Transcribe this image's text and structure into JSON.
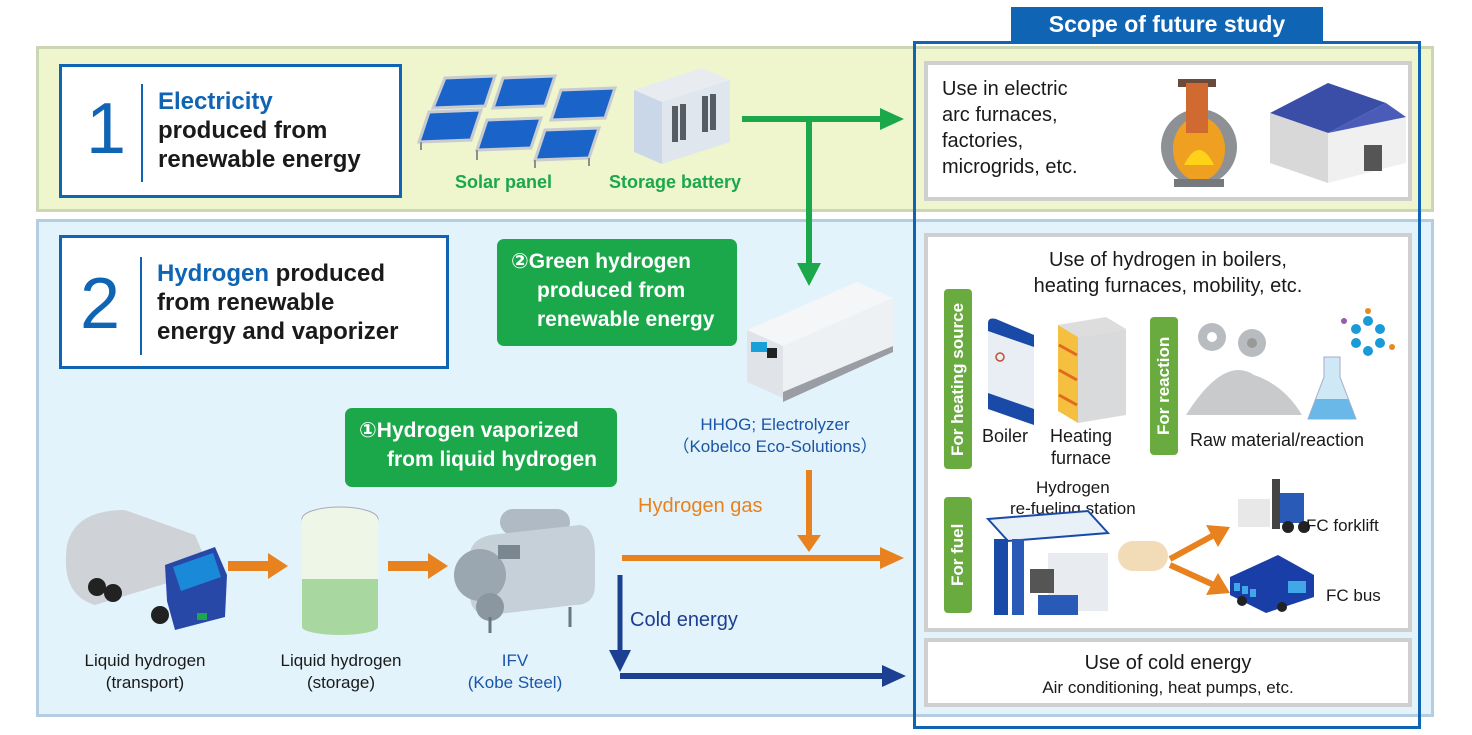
{
  "scope": {
    "title": "Scope of future study"
  },
  "section1": {
    "number": "1",
    "title_highlight": "Electricity",
    "title_line2": "produced from",
    "title_line3": "renewable energy",
    "solar_label": "Solar panel",
    "battery_label": "Storage battery"
  },
  "section2": {
    "number": "2",
    "title_highlight": "Hydrogen",
    "title_line1_rest": " produced",
    "title_line2": "from renewable",
    "title_line3": "energy and vaporizer",
    "green_box_2": {
      "line1": "②Green hydrogen",
      "line2": "produced from",
      "line3": "renewable energy"
    },
    "green_box_1": {
      "line1": "①Hydrogen vaporized",
      "line2": "from liquid hydrogen"
    },
    "electrolyzer_label": {
      "line1": "HHOG; Electrolyzer",
      "line2": "（Kobelco Eco-Solutions）"
    },
    "hydrogen_gas_label": "Hydrogen gas",
    "cold_energy_label": "Cold energy",
    "chain": [
      {
        "line1": "Liquid hydrogen",
        "line2": "(transport)"
      },
      {
        "line1": "Liquid hydrogen",
        "line2": "(storage)"
      },
      {
        "line1": "IFV",
        "line2": "(Kobe Steel)"
      }
    ]
  },
  "uses": {
    "electric": {
      "line1": "Use in electric",
      "line2": "arc furnaces,",
      "line3": "factories,",
      "line4": "microgrids, etc."
    },
    "hydrogen": {
      "title_line1": "Use of hydrogen in boilers,",
      "title_line2": "heating furnaces, mobility, etc.",
      "tag_heating": "For heating source",
      "tag_reaction": "For reaction",
      "tag_fuel": "For fuel",
      "boiler": "Boiler",
      "furnace_line1": "Heating",
      "furnace_line2": "furnace",
      "raw": "Raw material/reaction",
      "station_line1": "Hydrogen",
      "station_line2": "re-fueling station",
      "forklift": "FC forklift",
      "bus": "FC bus"
    },
    "cold": {
      "title": "Use of cold energy",
      "subtitle": "Air conditioning, heat pumps, etc."
    }
  },
  "colors": {
    "brand_blue": "#1064b4",
    "green": "#1aa84a",
    "orange": "#e8821e",
    "navy": "#1c3f91",
    "band1_bg": "#eff5cd",
    "band2_bg": "#e3f3fb"
  }
}
